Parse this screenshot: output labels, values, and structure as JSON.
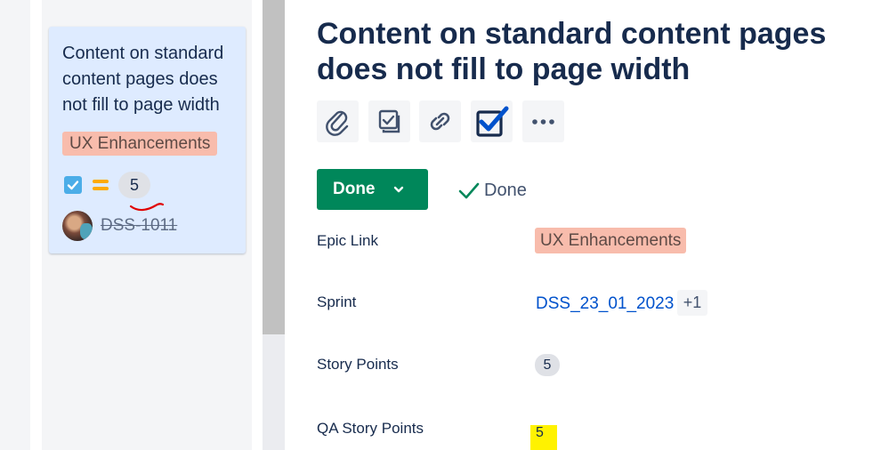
{
  "card": {
    "title": "Content on standard content pages does not fill to page width",
    "epic": "UX Enhancements",
    "issue_type_icon": "story-checkbox-icon",
    "priority_icon": "priority-medium-icon",
    "story_points": "5",
    "issue_key": "DSS-1011"
  },
  "detail": {
    "title": "Content on standard content pages does not fill to page width",
    "toolbar": [
      "attachment-icon",
      "child-issues-icon",
      "link-issue-icon",
      "task-checkbox-icon",
      "more-icon"
    ],
    "status_label": "Done",
    "resolution": "Done"
  },
  "fields": {
    "epic_link": {
      "label": "Epic Link",
      "value": "UX Enhancements"
    },
    "sprint": {
      "label": "Sprint",
      "value": "DSS_23_01_2023",
      "more": "+1"
    },
    "story_points": {
      "label": "Story Points",
      "value": "5"
    },
    "qa_story_points": {
      "label": "QA Story Points",
      "value": "5"
    }
  },
  "colors": {
    "status_done": "#00875a",
    "epic_bg": "#f8bcac",
    "card_bg": "#deebff",
    "highlight": "#fff200",
    "annotation": "#e00000"
  }
}
